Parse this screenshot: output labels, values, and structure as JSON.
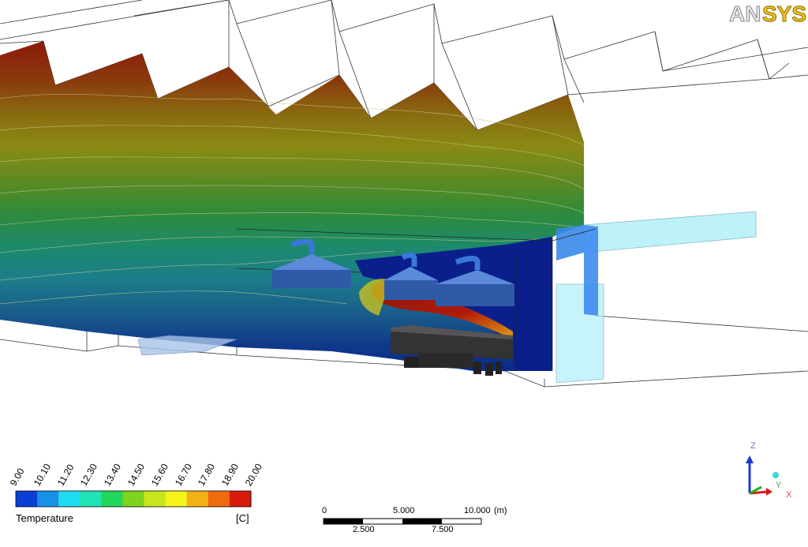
{
  "logo": {
    "text_an": "AN",
    "text_sys": "SYS"
  },
  "legend": {
    "title": "Temperature",
    "unit": "[C]",
    "ticks": [
      "9.00",
      "10.10",
      "11.20",
      "12.30",
      "13.40",
      "14.50",
      "15.60",
      "16.70",
      "17.80",
      "18.90",
      "20.00"
    ],
    "colors": [
      "#0a3fd6",
      "#1690e8",
      "#1fdcf0",
      "#1fe3b4",
      "#22d65c",
      "#7ed31c",
      "#c9e61c",
      "#f5f51b",
      "#f3b215",
      "#f06a10",
      "#d61b0c"
    ]
  },
  "scale_bar": {
    "top_labels": [
      "0",
      "5.000",
      "10.000"
    ],
    "unit": "(m)",
    "bottom_labels": [
      "2.500",
      "7.500"
    ]
  },
  "axes": {
    "z": "Z",
    "y": "Y",
    "x": "X"
  }
}
